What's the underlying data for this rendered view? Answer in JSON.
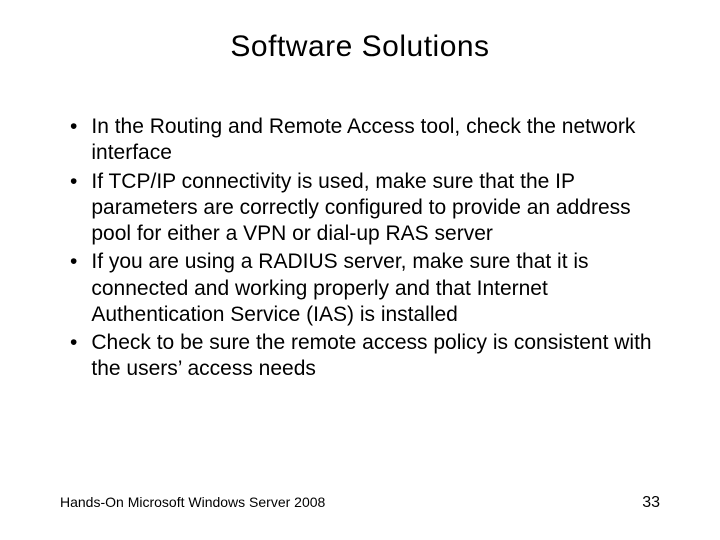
{
  "title": "Software Solutions",
  "bullets": [
    "In the Routing and Remote Access tool, check the network interface",
    "If TCP/IP connectivity is used, make sure that the IP parameters are correctly configured to provide an address pool for either a VPN or dial-up RAS server",
    "If you are using a RADIUS server, make sure that it is connected and working properly and that Internet Authentication Service (IAS) is installed",
    "Check to be sure the remote access policy is consistent with the users’ access needs"
  ],
  "footer_left": "Hands-On Microsoft Windows Server 2008",
  "footer_right": "33"
}
